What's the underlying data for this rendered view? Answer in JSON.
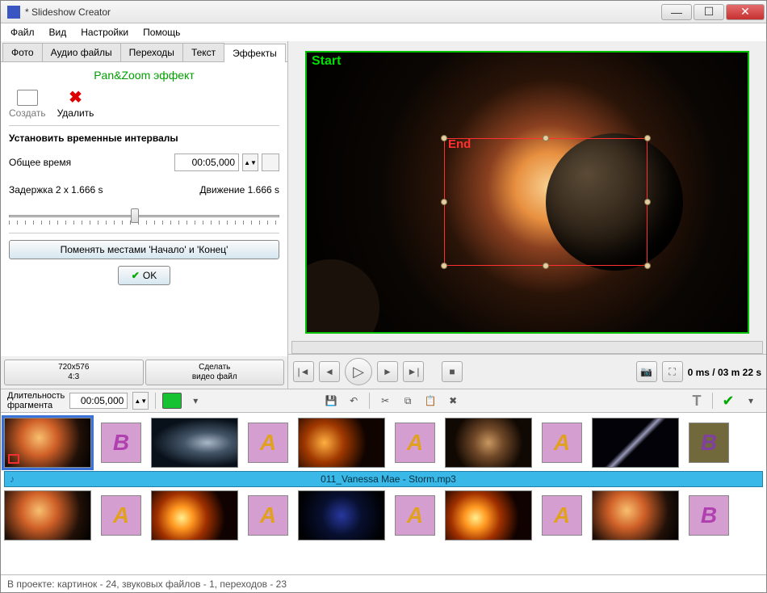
{
  "window": {
    "title": "* Slideshow Creator"
  },
  "menu": {
    "file": "Файл",
    "view": "Вид",
    "settings": "Настройки",
    "help": "Помощь"
  },
  "tabs": {
    "photo": "Фото",
    "audio": "Аудио файлы",
    "transitions": "Переходы",
    "text": "Текст",
    "effects": "Эффекты"
  },
  "effects": {
    "title": "Pan&Zoom эффект",
    "create": "Создать",
    "delete": "Удалить",
    "intervals_head": "Установить временные интервалы",
    "total_time_label": "Общее время",
    "total_time_value": "00:05,000",
    "delay_label": "Задержка 2 x 1.666 s",
    "motion_label": "Движение 1.666 s",
    "swap_button": "Поменять местами 'Начало' и 'Конец'",
    "ok": "OK"
  },
  "left_bottom": {
    "resolution": "720x576\n4:3",
    "make_video": "Сделать\nвидео файл"
  },
  "preview": {
    "start": "Start",
    "end": "End"
  },
  "playback": {
    "current": "0 ms",
    "sep": " / ",
    "total": "03 m 22 s"
  },
  "tl_toolbar": {
    "fragment_duration_label": "Длительность\nфрагмента",
    "fragment_duration_value": "00:05,000"
  },
  "timeline": {
    "audio_name": "011_Vanessa Mae - Storm.mp3",
    "row1_trans": [
      "B",
      "A",
      "A",
      "A",
      "B"
    ],
    "row2_trans": [
      "A",
      "A",
      "A",
      "A",
      "B"
    ]
  },
  "status": {
    "text": "В проекте: картинок - 24, звуковых файлов - 1, переходов - 23"
  }
}
